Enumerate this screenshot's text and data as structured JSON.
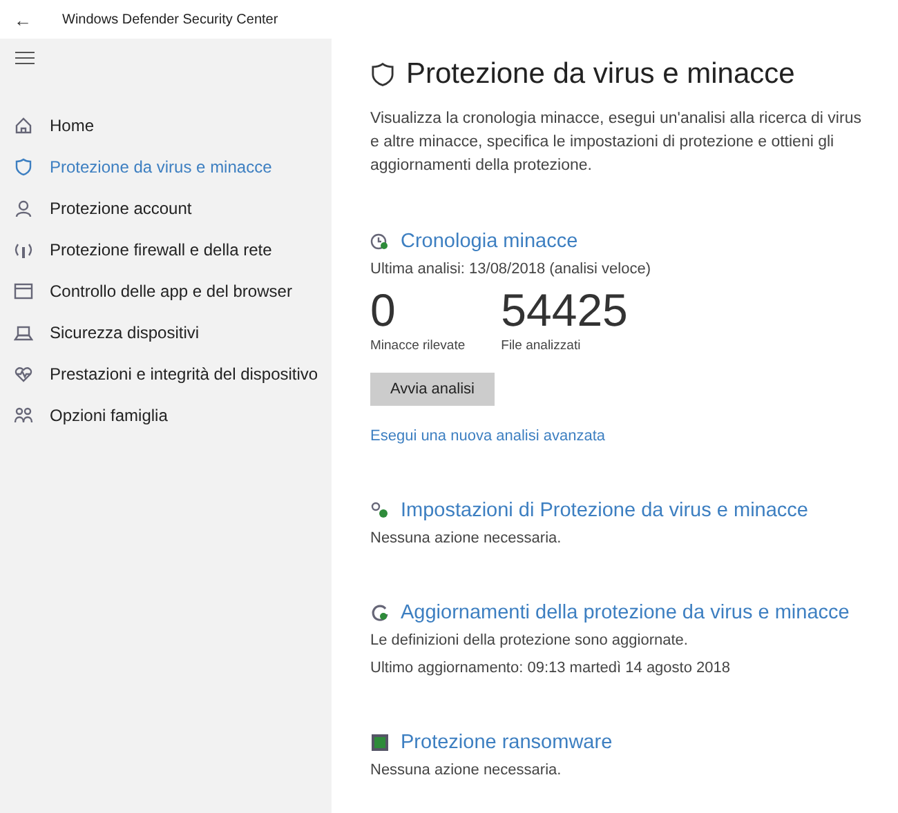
{
  "window": {
    "title": "Windows Defender Security Center",
    "back": "←"
  },
  "sidebar": {
    "items": [
      {
        "label": "Home",
        "selected": false
      },
      {
        "label": "Protezione da virus e minacce",
        "selected": true
      },
      {
        "label": "Protezione account",
        "selected": false
      },
      {
        "label": "Protezione firewall e della rete",
        "selected": false
      },
      {
        "label": "Controllo delle app e del browser",
        "selected": false
      },
      {
        "label": "Sicurezza dispositivi",
        "selected": false
      },
      {
        "label": "Prestazioni e integrità del dispositivo",
        "selected": false
      },
      {
        "label": "Opzioni famiglia",
        "selected": false
      }
    ]
  },
  "page": {
    "title": "Protezione da virus e minacce",
    "description": "Visualizza la cronologia minacce, esegui un'analisi alla ricerca di virus e altre minacce, specifica le impostazioni di protezione e ottieni gli aggiornamenti della protezione."
  },
  "threat_history": {
    "title": "Cronologia minacce",
    "last_scan": "Ultima analisi: 13/08/2018 (analisi veloce)",
    "stats": [
      {
        "value": "0",
        "label": "Minacce rilevate"
      },
      {
        "value": "54425",
        "label": "File analizzati"
      }
    ],
    "button": "Avvia analisi",
    "link": "Esegui una nuova analisi avanzata"
  },
  "sections": [
    {
      "title": "Impostazioni di Protezione da virus e minacce",
      "lines": [
        "Nessuna azione necessaria."
      ]
    },
    {
      "title": "Aggiornamenti della protezione da virus e minacce",
      "lines": [
        "Le definizioni della protezione sono aggiornate.",
        "Ultimo aggiornamento: 09:13 martedì 14 agosto 2018"
      ]
    },
    {
      "title": "Protezione ransomware",
      "lines": [
        "Nessuna azione necessaria."
      ]
    }
  ]
}
